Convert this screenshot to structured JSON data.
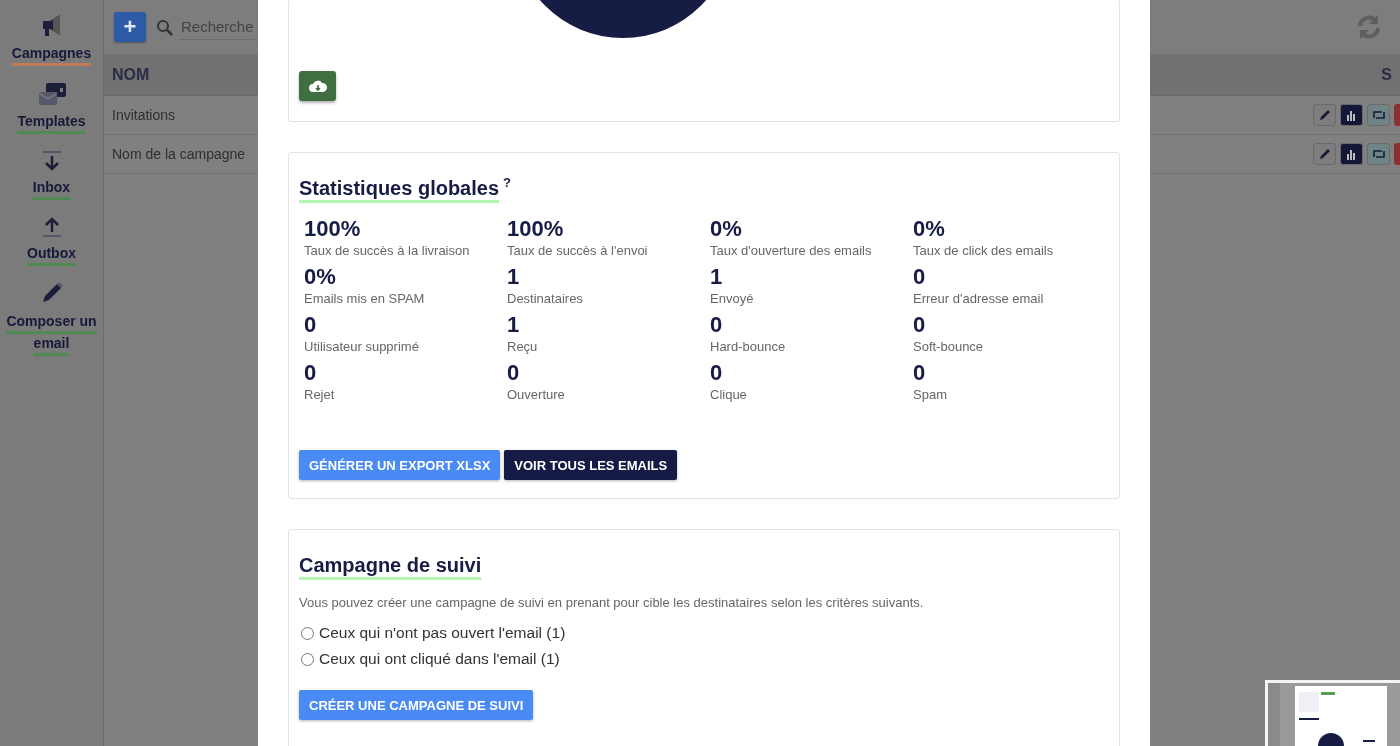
{
  "sidebar": {
    "items": [
      {
        "label": "Campagnes",
        "selected": true
      },
      {
        "label": "Templates",
        "selected": false
      },
      {
        "label": "Inbox",
        "selected": false
      },
      {
        "label": "Outbox",
        "selected": false
      },
      {
        "label": "Composer un email",
        "selected": false
      }
    ]
  },
  "toolbar": {
    "add_button": "+",
    "search": {
      "placeholder": "Recherche"
    }
  },
  "table": {
    "columns": [
      "NOM",
      "S"
    ],
    "rows": [
      {
        "name": "Invitations"
      },
      {
        "name": "Nom de la campagne"
      }
    ]
  },
  "modal": {
    "global_stats": {
      "title": "Statistiques globales",
      "help": "?",
      "stats": [
        {
          "value": "100%",
          "label": "Taux de succès à la livraison"
        },
        {
          "value": "100%",
          "label": "Taux de succès à l'envoi"
        },
        {
          "value": "0%",
          "label": "Taux d'ouverture des emails"
        },
        {
          "value": "0%",
          "label": "Taux de click des emails"
        },
        {
          "value": "0%",
          "label": "Emails mis en SPAM"
        },
        {
          "value": "1",
          "label": "Destinataires"
        },
        {
          "value": "1",
          "label": "Envoyé"
        },
        {
          "value": "0",
          "label": "Erreur d'adresse email"
        },
        {
          "value": "0",
          "label": "Utilisateur supprimé"
        },
        {
          "value": "1",
          "label": "Reçu"
        },
        {
          "value": "0",
          "label": "Hard-bounce"
        },
        {
          "value": "0",
          "label": "Soft-bounce"
        },
        {
          "value": "0",
          "label": "Rejet"
        },
        {
          "value": "0",
          "label": "Ouverture"
        },
        {
          "value": "0",
          "label": "Clique"
        },
        {
          "value": "0",
          "label": "Spam"
        }
      ],
      "buttons": [
        {
          "label": "GÉNÉRER UN EXPORT XLSX",
          "kind": "primary"
        },
        {
          "label": "VOIR TOUS LES EMAILS",
          "kind": "dark"
        }
      ]
    },
    "follow_up": {
      "title": "Campagne de suivi",
      "description": "Vous pouvez créer une campagne de suivi en prenant pour cible les destinataires selon les critères suivants.",
      "options": [
        {
          "label": "Ceux qui n'ont pas ouvert l'email (1)",
          "selected": false
        },
        {
          "label": "Ceux qui ont cliqué dans l'email (1)",
          "selected": false
        }
      ],
      "button": "CRÉER UNE CAMPAGNE DE SUIVI"
    }
  }
}
